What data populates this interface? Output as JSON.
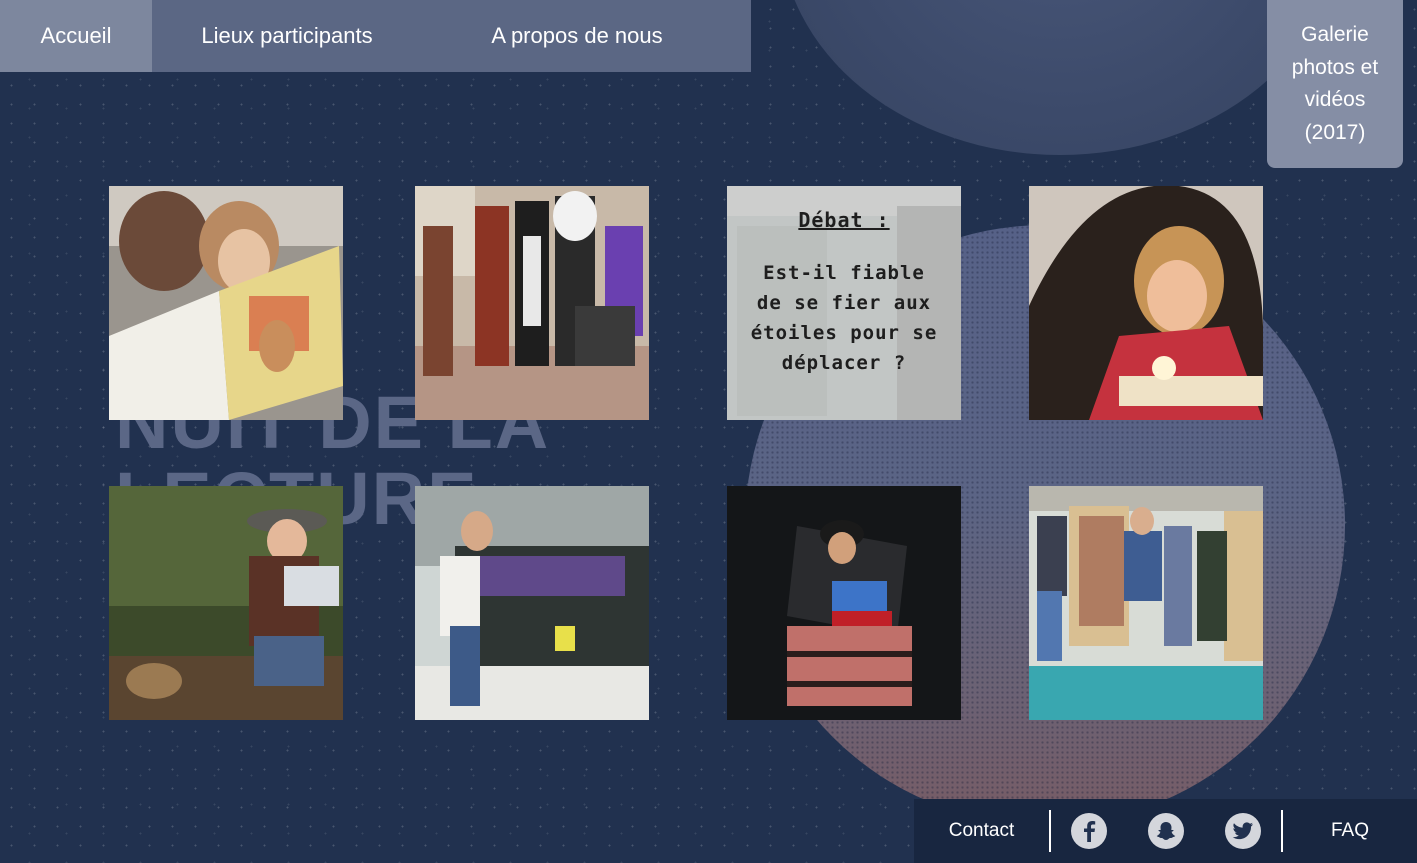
{
  "nav": {
    "accueil": "Accueil",
    "lieux": "Lieux participants",
    "apropos": "A propos de nous",
    "gallery": "Galerie photos et vidéos (2017)"
  },
  "background_title": "NUIT DE LA LECTURE",
  "debate": {
    "title": "Débat :",
    "question": "Est-il fiable de se fier aux étoiles pour se déplacer ?"
  },
  "footer": {
    "contact": "Contact",
    "faq": "FAQ",
    "social": [
      "facebook-icon",
      "snapchat-icon",
      "twitter-icon"
    ]
  },
  "colors": {
    "background": "#21314f",
    "nav_bar": "#5b6784",
    "nav_active": "#7d879e",
    "gallery_button": "#858ea5",
    "footer": "#182640"
  }
}
